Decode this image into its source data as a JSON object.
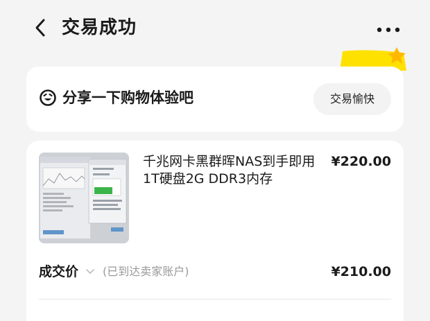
{
  "header": {
    "title": "交易成功",
    "back_icon": "chevron-left-icon",
    "more_icon": "more-dots-icon"
  },
  "share": {
    "icon": "smile-icon",
    "text": "分享一下购物体验吧",
    "button_label": "交易愉快"
  },
  "order": {
    "item_title": "千兆网卡黑群晖NAS到手即用1T硬盘2G DDR3内存",
    "item_price": "¥220.00",
    "deal_label": "成交价",
    "deal_note": "(已到达卖家账户)",
    "deal_price": "¥210.00"
  },
  "colors": {
    "background": "#f4f4f4",
    "card": "#ffffff",
    "accent_yellow": "#ffe100",
    "muted_text": "#999999"
  }
}
